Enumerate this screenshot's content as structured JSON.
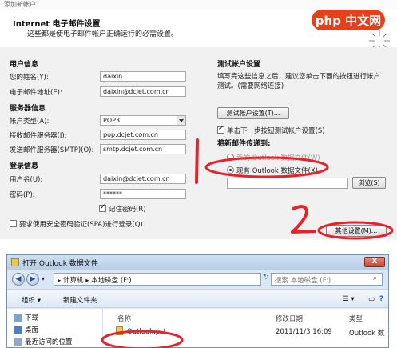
{
  "window": {
    "title": "添加新帐户"
  },
  "header": {
    "title": "Internet 电子邮件设置",
    "subtitle": "这些都是使电子邮件帐户正确运行的必需设置。",
    "logo_text": "php 中文网"
  },
  "user_info": {
    "section": "用户信息",
    "name_label": "您的姓名(Y):",
    "name_value": "daixin",
    "email_label": "电子邮件地址(E):",
    "email_value": "daixin@dcjet.com.cn"
  },
  "server_info": {
    "section": "服务器信息",
    "account_type_label": "帐户类型(A):",
    "account_type_value": "POP3",
    "incoming_label": "接收邮件服务器(I):",
    "incoming_value": "pop.dcjet.com.cn",
    "outgoing_label": "发送邮件服务器(SMTP)(O):",
    "outgoing_value": "smtp.dcjet.com.cn"
  },
  "login_info": {
    "section": "登录信息",
    "username_label": "用户名(U):",
    "username_value": "daixin@dcjet.com.cn",
    "password_label": "密码(P):",
    "password_value": "******",
    "remember_label": "记住密码(R)",
    "remember_checked": true,
    "spa_label": "要求使用安全密码验证(SPA)进行登录(Q)",
    "spa_checked": false
  },
  "test_settings": {
    "section": "测试帐户设置",
    "desc_line1": "填写完这些信息之后，建议您单击下面的按钮进行帐户",
    "desc_line2": "测试。(需要网络连接)",
    "test_button": "测试帐户设置(T)...",
    "auto_test_label": "单击下一步按钮测试帐户设置(S)",
    "auto_test_checked": true,
    "deliver_section": "将新邮件传递到:",
    "radio_new_label": "新的 Outlook 数据文件(W)",
    "radio_existing_label": "现有 Outlook 数据文件(X)",
    "selected": "existing",
    "browse_button": "浏览(S)",
    "more_settings_button": "其他设置(M)..."
  },
  "explorer": {
    "title": "打开 Outlook 数据文件",
    "close": "X",
    "breadcrumb": [
      "计算机",
      "本地磁盘 (F:)"
    ],
    "search_placeholder": "搜索 本地磁盘 (F:)",
    "toolbar": {
      "organize": "组织 ▾",
      "new_folder": "新建文件夹"
    },
    "nav_items": [
      "下载",
      "桌面",
      "最近访问的位置"
    ],
    "columns": [
      "名称",
      "修改日期",
      "类型"
    ],
    "file": {
      "name": "Outlook.pst",
      "date": "2011/11/3 16:09",
      "type": "Outlook 数"
    }
  },
  "annotations": {
    "mark_one": "1",
    "mark_two": "2"
  },
  "colors": {
    "annotation_red": "#e8222a",
    "logo_orange": "#e2411b",
    "explorer_blue": "#dbe7f4"
  }
}
